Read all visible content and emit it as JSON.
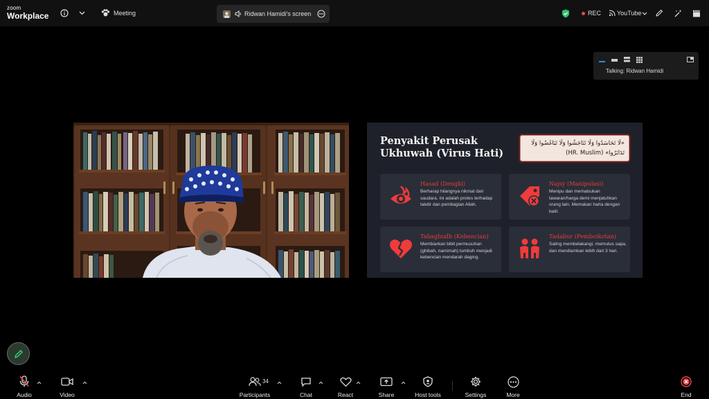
{
  "app": {
    "logo_line1": "zoom",
    "logo_line2": "Workplace"
  },
  "topbar": {
    "meeting_label": "Meeting",
    "share_tab_label": "Ridwan Hamidi's screen",
    "rec_label": "REC",
    "youtube_label": "YouTube"
  },
  "talking_panel": {
    "label": "Talking: Ridwan Hamidi"
  },
  "slide": {
    "title_line1": "Penyakit Perusak",
    "title_line2": "Ukhuwah (Virus Hati)",
    "hadith_text": "«لَا تَحَاسَدُوا وَلَا تَنَاجَشُوا وَلَا تَبَاغَضُوا وَلَا تَدَابَرُوا» (HR. Muslim)",
    "cards": [
      {
        "title": "Hasad (Dengki)",
        "desc": "Berharap hilangnya nikmat dari saudara. Ini adalah protes terhadap takdir dan pembagian Allah.",
        "icon": "eye-fire-icon"
      },
      {
        "title": "Najsy (Manipulasi)",
        "desc": "Menipu dan memalsukan tawaran/harga demi menjatuhkan orang lain. Memakan harta dengan batil.",
        "icon": "price-tag-x-icon"
      },
      {
        "title": "Tabaghudh (Kebencian)",
        "desc": "Membiarkan bibit permusuhan (ghibah, namimah) tumbuh menjadi kebencian mendarah daging.",
        "icon": "broken-heart-icon"
      },
      {
        "title": "Tadabur (Pemboikotan)",
        "desc": "Saling membelakangi, memutus sapa, dan mendiamkan lebih dari 3 hari.",
        "icon": "people-back-to-back-icon"
      }
    ],
    "accent_color": "#ef3b3b"
  },
  "toolbar": {
    "audio": "Audio",
    "video": "Video",
    "participants": "Participants",
    "participants_count": "34",
    "chat": "Chat",
    "react": "React",
    "share": "Share",
    "host_tools": "Host tools",
    "settings": "Settings",
    "more": "More",
    "end": "End"
  }
}
